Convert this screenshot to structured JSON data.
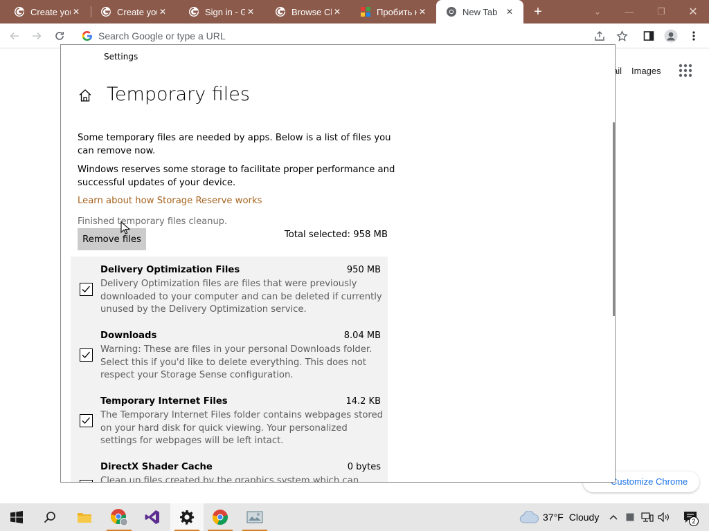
{
  "browser": {
    "tabs": [
      {
        "title": "Create your",
        "icon": "google-icon",
        "active": false
      },
      {
        "title": "Create your",
        "icon": "google-icon",
        "active": false
      },
      {
        "title": "Sign in - Go",
        "icon": "google-icon",
        "active": false
      },
      {
        "title": "Browse Chr",
        "icon": "google-icon",
        "active": false
      },
      {
        "title": "Пробить н",
        "icon": "colorful-grid-icon",
        "active": false
      },
      {
        "title": "New Tab",
        "icon": "chrome-icon",
        "active": true
      }
    ],
    "omnibox_placeholder": "Search Google or type a URL",
    "tabstrip_color": "#8b5a4b"
  },
  "newtab": {
    "gmail_label": "Gmail",
    "images_label": "Images",
    "customize_label": "Customize Chrome"
  },
  "settings": {
    "window_title": "Settings",
    "page_title": "Temporary files",
    "intro_text": "Some temporary files are needed by apps. Below is a list of files you can remove now.",
    "reserve_text": "Windows reserves some storage to facilitate proper performance and successful updates of your device.",
    "link_text": "Learn about how Storage Reserve works",
    "status_text": "Finished temporary files cleanup.",
    "remove_button_label": "Remove files",
    "total_selected": "Total selected: 958 MB",
    "link_color": "#a7631f",
    "items": [
      {
        "name": "Delivery Optimization Files",
        "size": "950 MB",
        "checked": true,
        "description": "Delivery Optimization files are files that were previously downloaded to your computer and can be deleted if currently unused by the Delivery Optimization service."
      },
      {
        "name": "Downloads",
        "size": "8.04 MB",
        "checked": true,
        "description": "Warning: These are files in your personal Downloads folder. Select this if you'd like to delete everything. This does not respect your Storage Sense configuration."
      },
      {
        "name": "Temporary Internet Files",
        "size": "14.2 KB",
        "checked": true,
        "description": "The Temporary Internet Files folder contains webpages stored on your hard disk for quick viewing. Your personalized settings for webpages will be left intact."
      },
      {
        "name": "DirectX Shader Cache",
        "size": "0 bytes",
        "checked": true,
        "description": "Clean up files created by the graphics system which can speed up application load time and improve responsiveness."
      }
    ]
  },
  "taskbar": {
    "apps": [
      "windows-start-icon",
      "search-icon",
      "file-explorer-icon",
      "chrome-profile-icon",
      "visual-studio-icon",
      "settings-gear-icon",
      "chrome-icon",
      "photos-icon"
    ],
    "weather_temp": "37°F",
    "weather_text": "Cloudy",
    "notification_count": "2",
    "accent_color": "#d9802b"
  }
}
